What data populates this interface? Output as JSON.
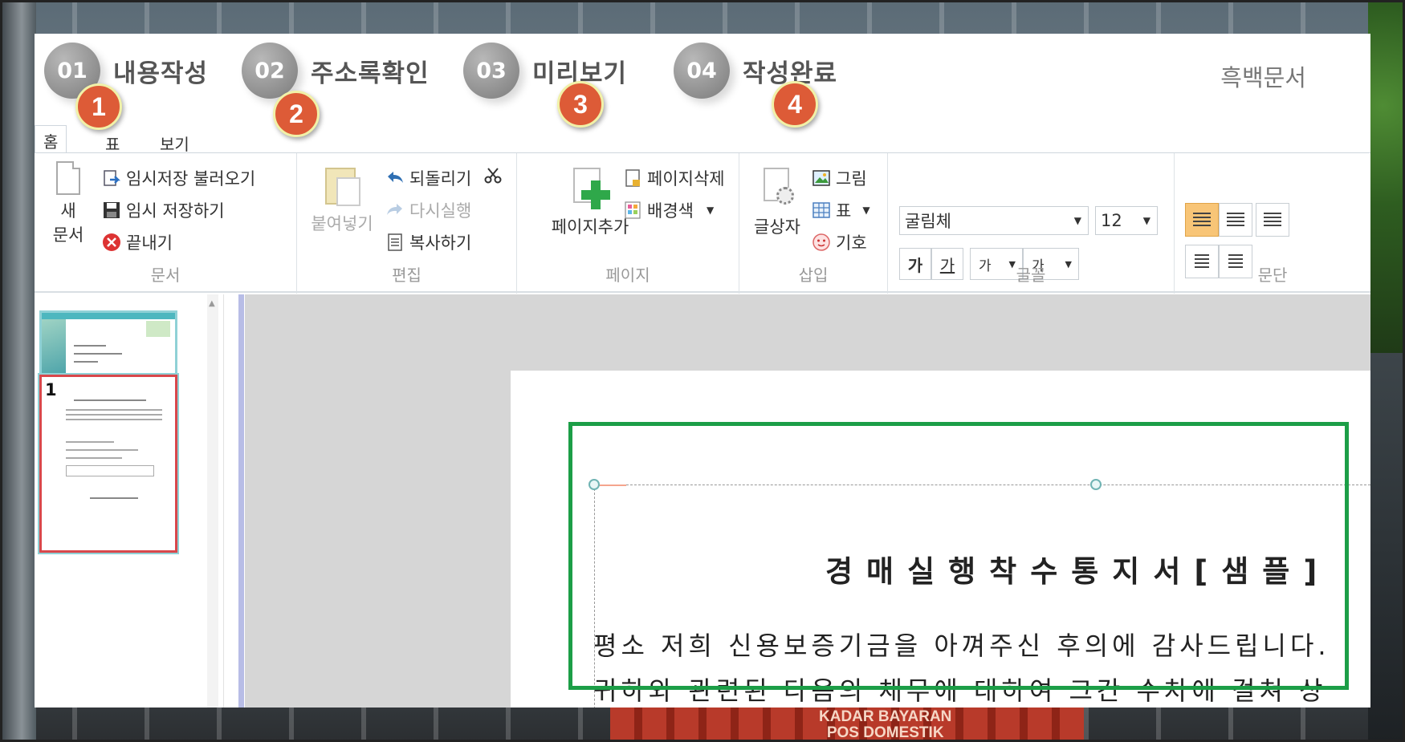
{
  "wizard": {
    "steps": [
      {
        "num": "01",
        "label": "내용작성"
      },
      {
        "num": "02",
        "label": "주소록확인"
      },
      {
        "num": "03",
        "label": "미리보기"
      },
      {
        "num": "04",
        "label": "작성완료"
      }
    ],
    "mode_label": "흑백문서"
  },
  "markers": [
    "1",
    "2",
    "3",
    "4"
  ],
  "tabs": [
    "홈",
    "표",
    "보기"
  ],
  "ribbon": {
    "document": {
      "new_doc_line1": "새",
      "new_doc_line2": "문서",
      "load_temp": "임시저장 불러오기",
      "save_temp": "임시 저장하기",
      "exit": "끝내기",
      "title": "문서"
    },
    "edit": {
      "paste": "붙여넣기",
      "undo": "되돌리기",
      "redo": "다시실행",
      "copy": "복사하기",
      "title": "편집"
    },
    "page": {
      "add": "페이지추가",
      "delete": "페이지삭제",
      "bgcolor": "배경색",
      "title": "페이지"
    },
    "insert": {
      "textbox": "글상자",
      "image": "그림",
      "table": "표",
      "symbol": "기호",
      "title": "삽입"
    },
    "font": {
      "family": "굴림체",
      "size": "12",
      "bold": "가",
      "underline": "가",
      "fontsize_btn": "가",
      "color_btn": "가",
      "title": "글꼴"
    },
    "paragraph": {
      "title": "문단"
    }
  },
  "thumbnails": [
    "0",
    "1"
  ],
  "document": {
    "title": "경매실행착수통지서[샘플]",
    "line1": "평소 저희 신용보증기금을 아껴주신 후의에 감사드립니다.",
    "line2": "귀하와 관련된 다음의 채무에 대하여 그간 수차에 걸쳐 상"
  },
  "background": {
    "banner_line1": "KADAR BAYARAN",
    "banner_line2": "POS DOMESTIK"
  },
  "colors": {
    "marker": "#dd5b37",
    "highlight_box": "#1c9e47",
    "active_align": "#f8c577"
  }
}
